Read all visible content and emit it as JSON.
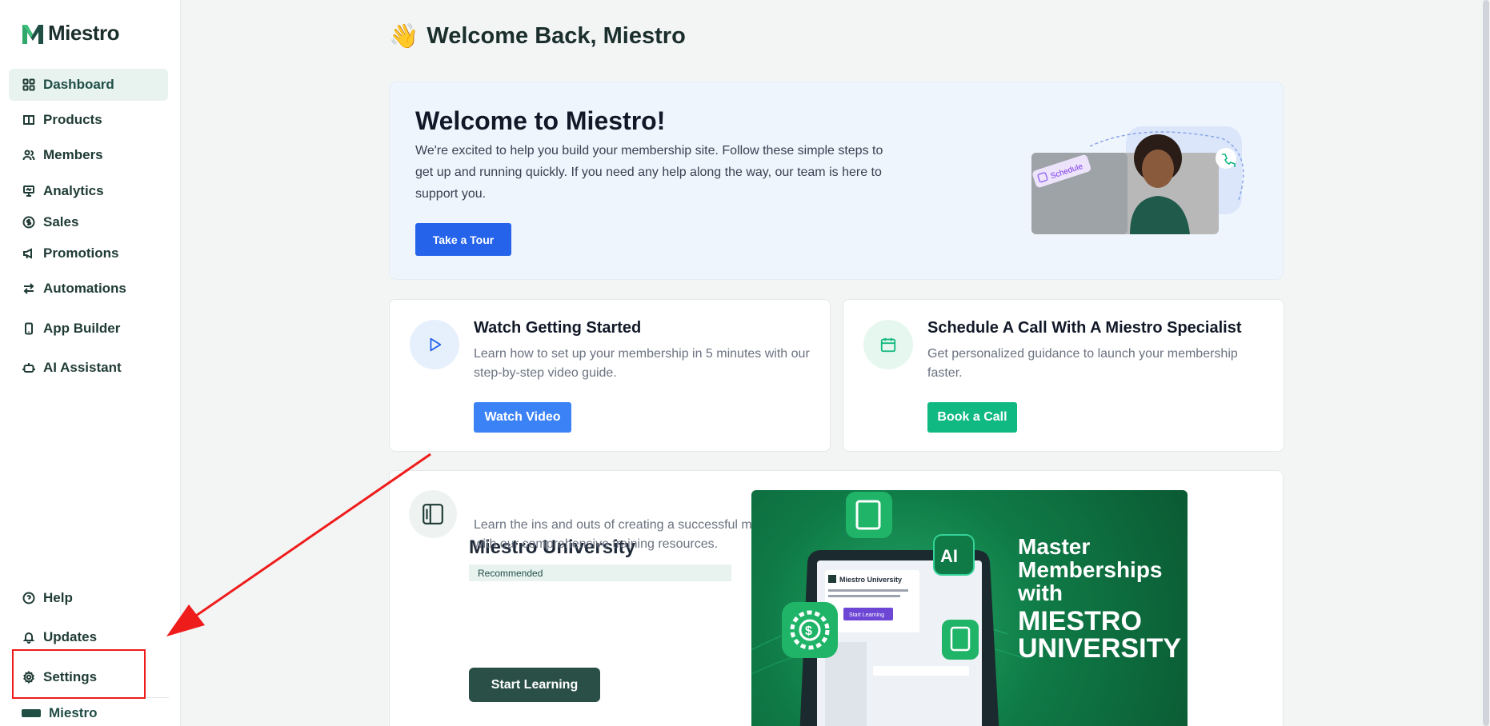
{
  "brand": {
    "name": "Miestro"
  },
  "sidebar": {
    "items": [
      {
        "label": "Dashboard",
        "icon": "dashboard-icon",
        "active": true
      },
      {
        "label": "Products",
        "icon": "book-icon"
      },
      {
        "label": "Members",
        "icon": "users-icon"
      },
      {
        "label": "Analytics",
        "icon": "presentation-icon"
      },
      {
        "label": "Sales",
        "icon": "dollar-icon"
      },
      {
        "label": "Promotions",
        "icon": "megaphone-icon"
      },
      {
        "label": "Automations",
        "icon": "arrows-icon"
      },
      {
        "label": "App Builder",
        "icon": "phone-icon"
      },
      {
        "label": "AI Assistant",
        "icon": "bot-icon"
      }
    ],
    "bottom_items": [
      {
        "label": "Help",
        "icon": "help-icon"
      },
      {
        "label": "Updates",
        "icon": "bell-icon"
      },
      {
        "label": "Settings",
        "icon": "gear-icon"
      }
    ],
    "account_name": "Miestro"
  },
  "main": {
    "greeting_emoji": "👋",
    "greeting": "Welcome Back, Miestro",
    "hero": {
      "title": "Welcome to Miestro!",
      "body": "We're excited to help you build your membership site. Follow these simple steps to get up and running quickly. If you need any help along the way, our team is here to support you.",
      "button": "Take a Tour",
      "tag": "Schedule"
    },
    "video_card": {
      "title": "Watch Getting Started",
      "body": "Learn how to set up your membership in 5 minutes with our step-by-step video guide.",
      "button": "Watch Video"
    },
    "call_card": {
      "title": "Schedule A Call With A Miestro Specialist",
      "body": "Get personalized guidance to launch your membership faster.",
      "button": "Book a Call"
    },
    "university_card": {
      "title": "Miestro University",
      "badge": "Recommended",
      "body": "Learn the ins and outs of creating a successful membership with our comprehensive training resources.",
      "button": "Start Learning",
      "banner_line1": "Master",
      "banner_line2": "Memberships",
      "banner_line3": "with",
      "banner_line4": "MIESTRO",
      "banner_line5": "UNIVERSITY",
      "banner_ai": "AI",
      "mock_title": "Miestro University",
      "mock_button": "Start Learning"
    }
  },
  "colors": {
    "brand_green": "#1f4e45",
    "primary_blue": "#2563eb",
    "success_green": "#10b981",
    "annotation_red": "#ef1c1c"
  }
}
